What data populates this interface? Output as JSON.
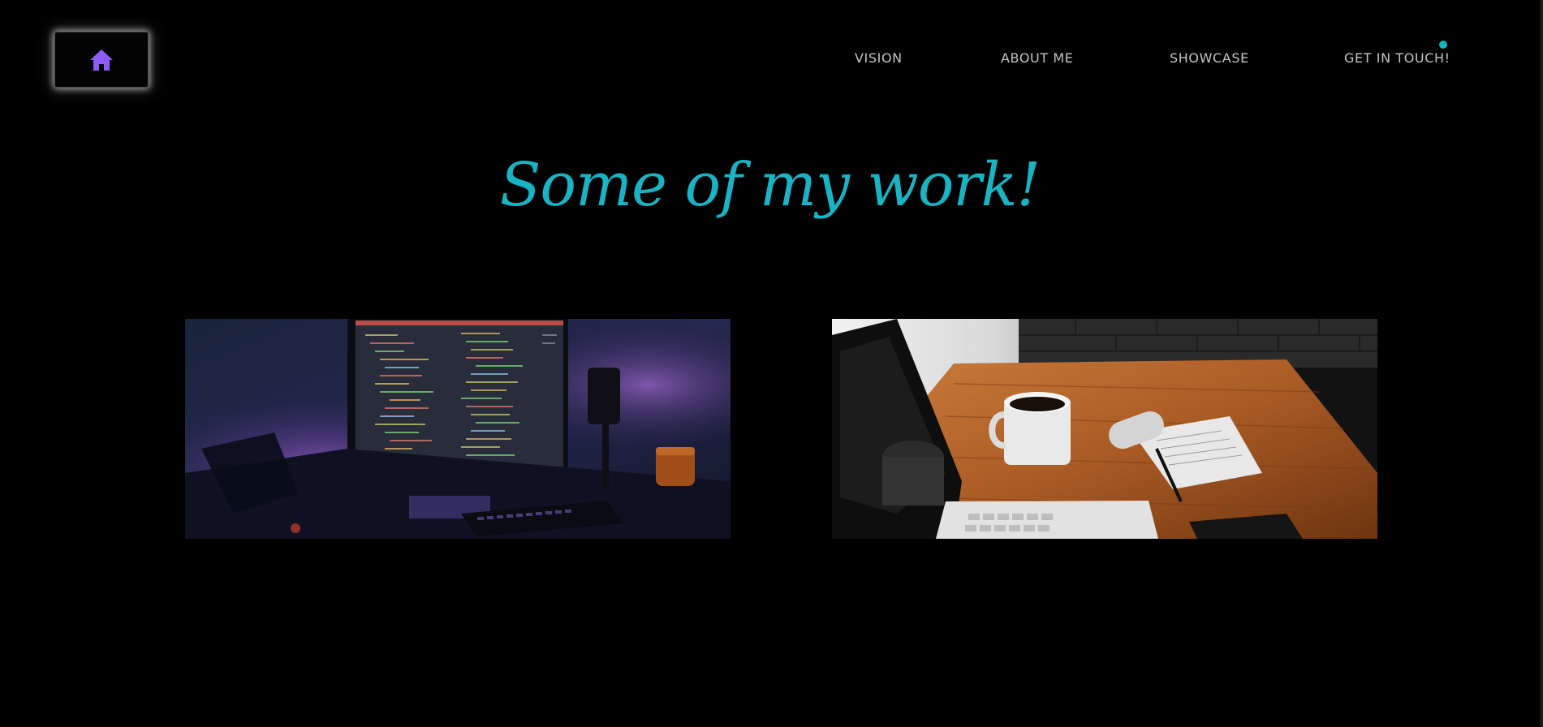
{
  "home": {
    "icon": "home-icon",
    "accent": "#8b5cf6"
  },
  "nav": {
    "items": [
      {
        "label": "VISION"
      },
      {
        "label": "ABOUT ME"
      },
      {
        "label": "SHOWCASE"
      },
      {
        "label": "GET IN TOUCH!"
      }
    ],
    "dot_color": "#12b5c0"
  },
  "main": {
    "headline": "Some of my work!",
    "headline_color": "#18b4c4"
  },
  "showcase": {
    "cards": [
      {
        "image": "code-monitor-desk-photo"
      },
      {
        "image": "coffee-mug-wooden-desk-photo"
      }
    ]
  }
}
